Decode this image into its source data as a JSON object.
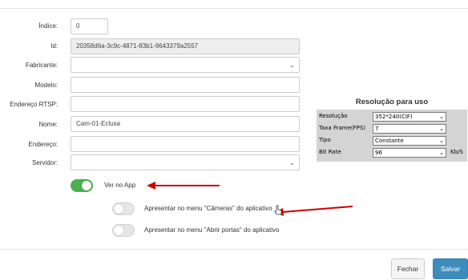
{
  "form": {
    "indice": {
      "label": "Índice:",
      "value": "0"
    },
    "id": {
      "label": "Id:",
      "value": "20358d6a-3c9c-4871-83b1-9643379a2557"
    },
    "fabricante": {
      "label": "Fabricante:",
      "value": ""
    },
    "modelo": {
      "label": "Modelo:",
      "value": ""
    },
    "endereco_rtsp": {
      "label": "Endereço RTSP:",
      "value": ""
    },
    "nome": {
      "label": "Nome:",
      "value": "Cam-01-Eclusa"
    },
    "endereco": {
      "label": "Endereço:",
      "value": ""
    },
    "servidor": {
      "label": "Servidor:",
      "value": ""
    }
  },
  "toggles": {
    "ver_no_app": {
      "label": "Ver no App",
      "on": true
    },
    "menu_cameras": {
      "label": "Apresentar no menu \"Câmeras\" do aplicativo",
      "on": false
    },
    "menu_abrir_portas": {
      "label": "Apresentar no menu \"Abrir portas\" do aplicativo",
      "on": false
    }
  },
  "resolution": {
    "title": "Resolução para uso",
    "rows": [
      {
        "label": "Resolução",
        "value": "352*240(CIF)"
      },
      {
        "label": "Taxa Frame(FPS)",
        "value": "7"
      },
      {
        "label": "Tipo",
        "value": "Constante"
      },
      {
        "label": "Bit Rate",
        "value": "96",
        "unit": "Kb/S"
      }
    ]
  },
  "footer": {
    "close_label": "Fechar",
    "save_label": "Salvar"
  },
  "colors": {
    "toggle_on": "#4caf50",
    "primary": "#3c8dbc",
    "annotation_arrow": "#cc0000"
  },
  "icons": {
    "select_arrow": "chevron-down-icon",
    "annotation": "red-arrow-icon",
    "cursor": "hand-cursor-icon"
  }
}
